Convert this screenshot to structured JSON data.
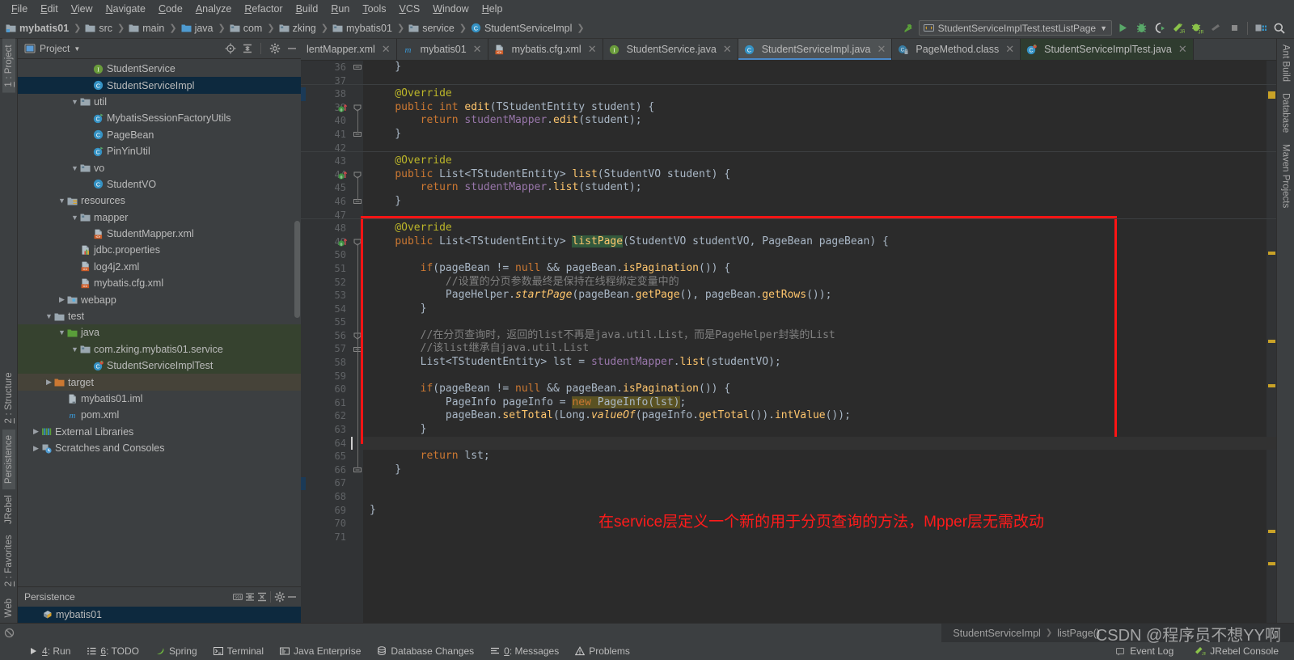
{
  "menu": {
    "items": [
      "File",
      "Edit",
      "View",
      "Navigate",
      "Code",
      "Analyze",
      "Refactor",
      "Build",
      "Run",
      "Tools",
      "VCS",
      "Window",
      "Help"
    ]
  },
  "breadcrumbs": [
    {
      "label": "mybatis01",
      "icon": "module-icon"
    },
    {
      "label": "src",
      "icon": "folder-icon"
    },
    {
      "label": "main",
      "icon": "folder-icon"
    },
    {
      "label": "java",
      "icon": "source-folder-icon"
    },
    {
      "label": "com",
      "icon": "package-icon"
    },
    {
      "label": "zking",
      "icon": "package-icon"
    },
    {
      "label": "mybatis01",
      "icon": "package-icon"
    },
    {
      "label": "service",
      "icon": "package-icon"
    },
    {
      "label": "StudentServiceImpl",
      "icon": "class-icon"
    }
  ],
  "toolbar": {
    "run_config": "StudentServiceImplTest.testListPage",
    "buttons": [
      "run-button",
      "debug-button",
      "run-with-coverage-button",
      "jrebel-run-button",
      "jrebel-debug-button",
      "stop-gradle-button",
      "stop-button",
      "project-structure-button",
      "search-everywhere-button"
    ]
  },
  "left_strip": {
    "top": [
      {
        "label": "1: Project",
        "active": true
      }
    ],
    "mid": [
      {
        "label": "2: Structure",
        "active": false
      },
      {
        "label": "Persistence",
        "active": true
      },
      {
        "label": "JRebel",
        "active": false
      }
    ],
    "bottom": [
      {
        "label": "2: Favorites",
        "active": false
      },
      {
        "label": "Web",
        "active": false
      }
    ]
  },
  "right_strip": {
    "items": [
      "Ant Build",
      "Database",
      "Maven Projects"
    ]
  },
  "project_panel": {
    "title": "Project",
    "tools": [
      "locate-icon",
      "collapse-all-icon",
      "settings-gear-icon",
      "hide-icon"
    ],
    "tree": [
      {
        "label": "StudentService",
        "indent": 5,
        "arrow": "",
        "icon": "interface-icon",
        "state": ""
      },
      {
        "label": "StudentServiceImpl",
        "indent": 5,
        "arrow": "",
        "icon": "class-icon",
        "state": "sel"
      },
      {
        "label": "util",
        "indent": 4,
        "arrow": "▼",
        "icon": "package-icon",
        "state": ""
      },
      {
        "label": "MybatisSessionFactoryUtils",
        "indent": 5,
        "arrow": "",
        "icon": "class-run-icon",
        "state": ""
      },
      {
        "label": "PageBean",
        "indent": 5,
        "arrow": "",
        "icon": "class-icon",
        "state": ""
      },
      {
        "label": "PinYinUtil",
        "indent": 5,
        "arrow": "",
        "icon": "class-run-icon",
        "state": ""
      },
      {
        "label": "vo",
        "indent": 4,
        "arrow": "▼",
        "icon": "package-icon",
        "state": ""
      },
      {
        "label": "StudentVO",
        "indent": 5,
        "arrow": "",
        "icon": "class-icon",
        "state": ""
      },
      {
        "label": "resources",
        "indent": 3,
        "arrow": "▼",
        "icon": "resource-folder-icon",
        "state": ""
      },
      {
        "label": "mapper",
        "indent": 4,
        "arrow": "▼",
        "icon": "package-icon",
        "state": ""
      },
      {
        "label": "StudentMapper.xml",
        "indent": 5,
        "arrow": "",
        "icon": "xml-file-icon",
        "state": ""
      },
      {
        "label": "jdbc.properties",
        "indent": 4,
        "arrow": "",
        "icon": "properties-file-icon",
        "state": ""
      },
      {
        "label": "log4j2.xml",
        "indent": 4,
        "arrow": "",
        "icon": "xml-file-icon",
        "state": ""
      },
      {
        "label": "mybatis.cfg.xml",
        "indent": 4,
        "arrow": "",
        "icon": "xml-file-icon",
        "state": ""
      },
      {
        "label": "webapp",
        "indent": 3,
        "arrow": "▶",
        "icon": "webapp-folder-icon",
        "state": ""
      },
      {
        "label": "test",
        "indent": 2,
        "arrow": "▼",
        "icon": "folder-icon",
        "state": ""
      },
      {
        "label": "java",
        "indent": 3,
        "arrow": "▼",
        "icon": "test-source-folder-icon",
        "state": "green"
      },
      {
        "label": "com.zking.mybatis01.service",
        "indent": 4,
        "arrow": "▼",
        "icon": "package-icon",
        "state": "green"
      },
      {
        "label": "StudentServiceImplTest",
        "indent": 5,
        "arrow": "",
        "icon": "test-class-icon",
        "state": "green"
      },
      {
        "label": "target",
        "indent": 2,
        "arrow": "▶",
        "icon": "excluded-folder-icon",
        "state": "brown"
      },
      {
        "label": "mybatis01.iml",
        "indent": 3,
        "arrow": "",
        "icon": "iml-file-icon",
        "state": ""
      },
      {
        "label": "pom.xml",
        "indent": 3,
        "arrow": "",
        "icon": "maven-file-icon",
        "state": ""
      },
      {
        "label": "External Libraries",
        "indent": 1,
        "arrow": "▶",
        "icon": "libraries-icon",
        "state": ""
      },
      {
        "label": "Scratches and Consoles",
        "indent": 1,
        "arrow": "▶",
        "icon": "scratches-icon",
        "state": ""
      }
    ]
  },
  "persistence_panel": {
    "title": "Persistence",
    "tools": [
      "sql-console-icon",
      "expand-all-icon",
      "collapse-all-icon",
      "settings-gear-icon",
      "hide-icon"
    ],
    "items": [
      {
        "label": "mybatis01",
        "icon": "persistence-unit-icon",
        "state": "sel"
      }
    ]
  },
  "editor_tabs": [
    {
      "label": "lentMapper.xml",
      "icon": "xml-file-icon",
      "active": false,
      "clipped": true
    },
    {
      "label": "mybatis01",
      "icon": "maven-file-icon",
      "active": false
    },
    {
      "label": "mybatis.cfg.xml",
      "icon": "xml-file-icon",
      "active": false
    },
    {
      "label": "StudentService.java",
      "icon": "interface-icon",
      "active": false
    },
    {
      "label": "StudentServiceImpl.java",
      "icon": "class-icon",
      "active": true
    },
    {
      "label": "PageMethod.class",
      "icon": "class-file-icon",
      "active": false
    },
    {
      "label": "StudentServiceImplTest.java",
      "icon": "test-class-icon",
      "active": false,
      "greenbg": true
    }
  ],
  "code": {
    "first_line_number": 36,
    "lines": [
      {
        "n": 36,
        "text": "    }"
      },
      {
        "n": 37,
        "text": ""
      },
      {
        "n": 38,
        "text": "    @Override"
      },
      {
        "n": 39,
        "text": "    public int edit(TStudentEntity student) {"
      },
      {
        "n": 40,
        "text": "        return studentMapper.edit(student);"
      },
      {
        "n": 41,
        "text": "    }"
      },
      {
        "n": 42,
        "text": ""
      },
      {
        "n": 43,
        "text": "    @Override"
      },
      {
        "n": 44,
        "text": "    public List<TStudentEntity> list(StudentVO student) {"
      },
      {
        "n": 45,
        "text": "        return studentMapper.list(student);"
      },
      {
        "n": 46,
        "text": "    }"
      },
      {
        "n": 47,
        "text": ""
      },
      {
        "n": 48,
        "text": "    @Override"
      },
      {
        "n": 49,
        "text": "    public List<TStudentEntity> listPage(StudentVO studentVO, PageBean pageBean) {"
      },
      {
        "n": 50,
        "text": ""
      },
      {
        "n": 51,
        "text": "        if(pageBean != null && pageBean.isPagination()) {"
      },
      {
        "n": 52,
        "text": "            //设置的分页参数最终是保持在线程绑定变量中的"
      },
      {
        "n": 53,
        "text": "            PageHelper.startPage(pageBean.getPage(), pageBean.getRows());"
      },
      {
        "n": 54,
        "text": "        }"
      },
      {
        "n": 55,
        "text": ""
      },
      {
        "n": 56,
        "text": "        //在分页查询时，返回的list不再是java.util.List，而是PageHelper封装的List"
      },
      {
        "n": 57,
        "text": "        //该list继承自java.util.List"
      },
      {
        "n": 58,
        "text": "        List<TStudentEntity> lst = studentMapper.list(studentVO);"
      },
      {
        "n": 59,
        "text": ""
      },
      {
        "n": 60,
        "text": "        if(pageBean != null && pageBean.isPagination()) {"
      },
      {
        "n": 61,
        "text": "            PageInfo pageInfo = new PageInfo(lst);"
      },
      {
        "n": 62,
        "text": "            pageBean.setTotal(Long.valueOf(pageInfo.getTotal()).intValue());"
      },
      {
        "n": 63,
        "text": "        }"
      },
      {
        "n": 64,
        "text": ""
      },
      {
        "n": 65,
        "text": "        return lst;"
      },
      {
        "n": 66,
        "text": "    }"
      },
      {
        "n": 67,
        "text": ""
      },
      {
        "n": 68,
        "text": ""
      },
      {
        "n": 69,
        "text": "}"
      },
      {
        "n": 70,
        "text": ""
      },
      {
        "n": 71,
        "text": ""
      }
    ]
  },
  "annotation": {
    "text": "在service层定义一个新的用于分页查询的方法，Mpper层无需改动",
    "color": "#ff1b1b",
    "box_color": "#ff1414"
  },
  "status_bar": {
    "breadcrumb": [
      "StudentServiceImpl",
      "listPage()"
    ],
    "tool_buttons": [
      {
        "label": "4: Run",
        "icon": "run-icon"
      },
      {
        "label": "6: TODO",
        "icon": "todo-icon"
      },
      {
        "label": "Spring",
        "icon": "spring-icon"
      },
      {
        "label": "Terminal",
        "icon": "terminal-icon"
      },
      {
        "label": "Java Enterprise",
        "icon": "java-ee-icon"
      },
      {
        "label": "Database Changes",
        "icon": "database-changes-icon"
      },
      {
        "label": "0: Messages",
        "icon": "messages-icon"
      },
      {
        "label": "Problems",
        "icon": "problems-icon"
      }
    ],
    "right_buttons": [
      {
        "label": "Event Log",
        "icon": "event-log-icon"
      },
      {
        "label": "JRebel Console",
        "icon": "jrebel-icon"
      }
    ]
  },
  "watermark": "CSDN @程序员不想YY啊"
}
